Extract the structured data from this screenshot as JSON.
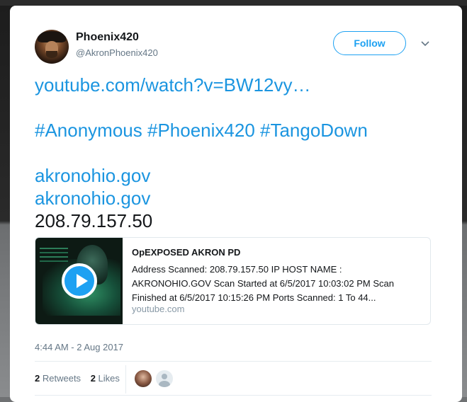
{
  "tweet": {
    "author": {
      "name": "Phoenix420",
      "handle": "@AkronPhoenix420"
    },
    "follow_label": "Follow",
    "body": {
      "link_youtube": "youtube.com/watch?v=BW12vy…",
      "hashtags": "#Anonymous #Phoenix420 #TangoDown",
      "link1": "akronohio.gov",
      "link2": "akronohio.gov",
      "ip": "208.79.157.50"
    },
    "card": {
      "title": "OpEXPOSED AKRON PD",
      "description": "Address Scanned: 208.79.157.50 IP HOST NAME : AKRONOHIO.GOV Scan Started at 6/5/2017 10:03:02 PM Scan Finished at 6/5/2017 10:15:26 PM Ports Scanned: 1 To 44...",
      "domain": "youtube.com"
    },
    "timestamp": "4:44 AM - 2 Aug 2017",
    "stats": {
      "retweets_count": "2",
      "retweets_label": "Retweets",
      "likes_count": "2",
      "likes_label": "Likes"
    }
  },
  "colors": {
    "accent": "#1da1f2",
    "link": "#1b95e0",
    "text": "#14171a",
    "muted": "#657786"
  }
}
